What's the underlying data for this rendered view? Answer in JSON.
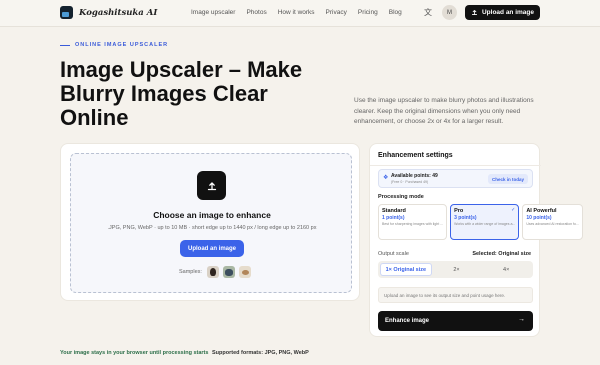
{
  "nav": {
    "brand": "Kogashitsuka AI",
    "links": [
      "Image upscaler",
      "Photos",
      "How it works",
      "Privacy",
      "Pricing",
      "Blog"
    ],
    "avatar_initial": "M",
    "upload_label": "Upload an image",
    "icons": {
      "logo": "app-logo",
      "language": "translate-icon",
      "upload": "upload-icon"
    }
  },
  "hero": {
    "eyebrow": "ONLINE IMAGE UPSCALER",
    "title": "Image Upscaler – Make Blurry Images Clear Online",
    "description": "Use the image upscaler to make blurry photos and illustrations clearer. Keep the original dimensions when you only need enhancement, or choose 2x or 4x for a larger result."
  },
  "dropzone": {
    "title": "Choose an image to enhance",
    "formats": ".JPG, PNG, WebP · up to 10 MB · short edge up to 1440 px / long edge up to 2160 px",
    "button": "Upload an image",
    "samples_label": "Samples:",
    "samples": [
      "portrait",
      "landscape",
      "food"
    ]
  },
  "settings": {
    "title": "Enhancement settings",
    "points": {
      "label": "Available points: 49",
      "sub": "(Free 0 · Purchased 49)",
      "checkin": "Check in today"
    },
    "mode_label": "Processing mode",
    "modes": [
      {
        "name": "Standard",
        "points": "1 point(s)",
        "desc": "Best for sharpening images with light ...",
        "selected": false
      },
      {
        "name": "Pro",
        "points": "3 point(s)",
        "desc": "Works with a wider range of images a...",
        "selected": true
      },
      {
        "name": "AI Powerful",
        "points": "10 point(s)",
        "desc": "Uses advanced AI restoration fo...",
        "selected": false
      }
    ],
    "scale_label": "Output scale",
    "scale_selected": "Selected: Original size",
    "scales": [
      "1× Original size",
      "2×",
      "4×"
    ],
    "active_scale": 0,
    "hint": "Upload an image to see its output size and point usage here.",
    "enhance_button": "Enhance image"
  },
  "footer": {
    "privacy": "Your image stays in your browser until processing starts",
    "formats_label": "Supported formats:",
    "formats_value": "JPG, PNG, WebP"
  },
  "colors": {
    "accent": "#3b63e9",
    "dark": "#111111",
    "background": "#f5f2ec",
    "privacy_green": "#2c6e49"
  }
}
